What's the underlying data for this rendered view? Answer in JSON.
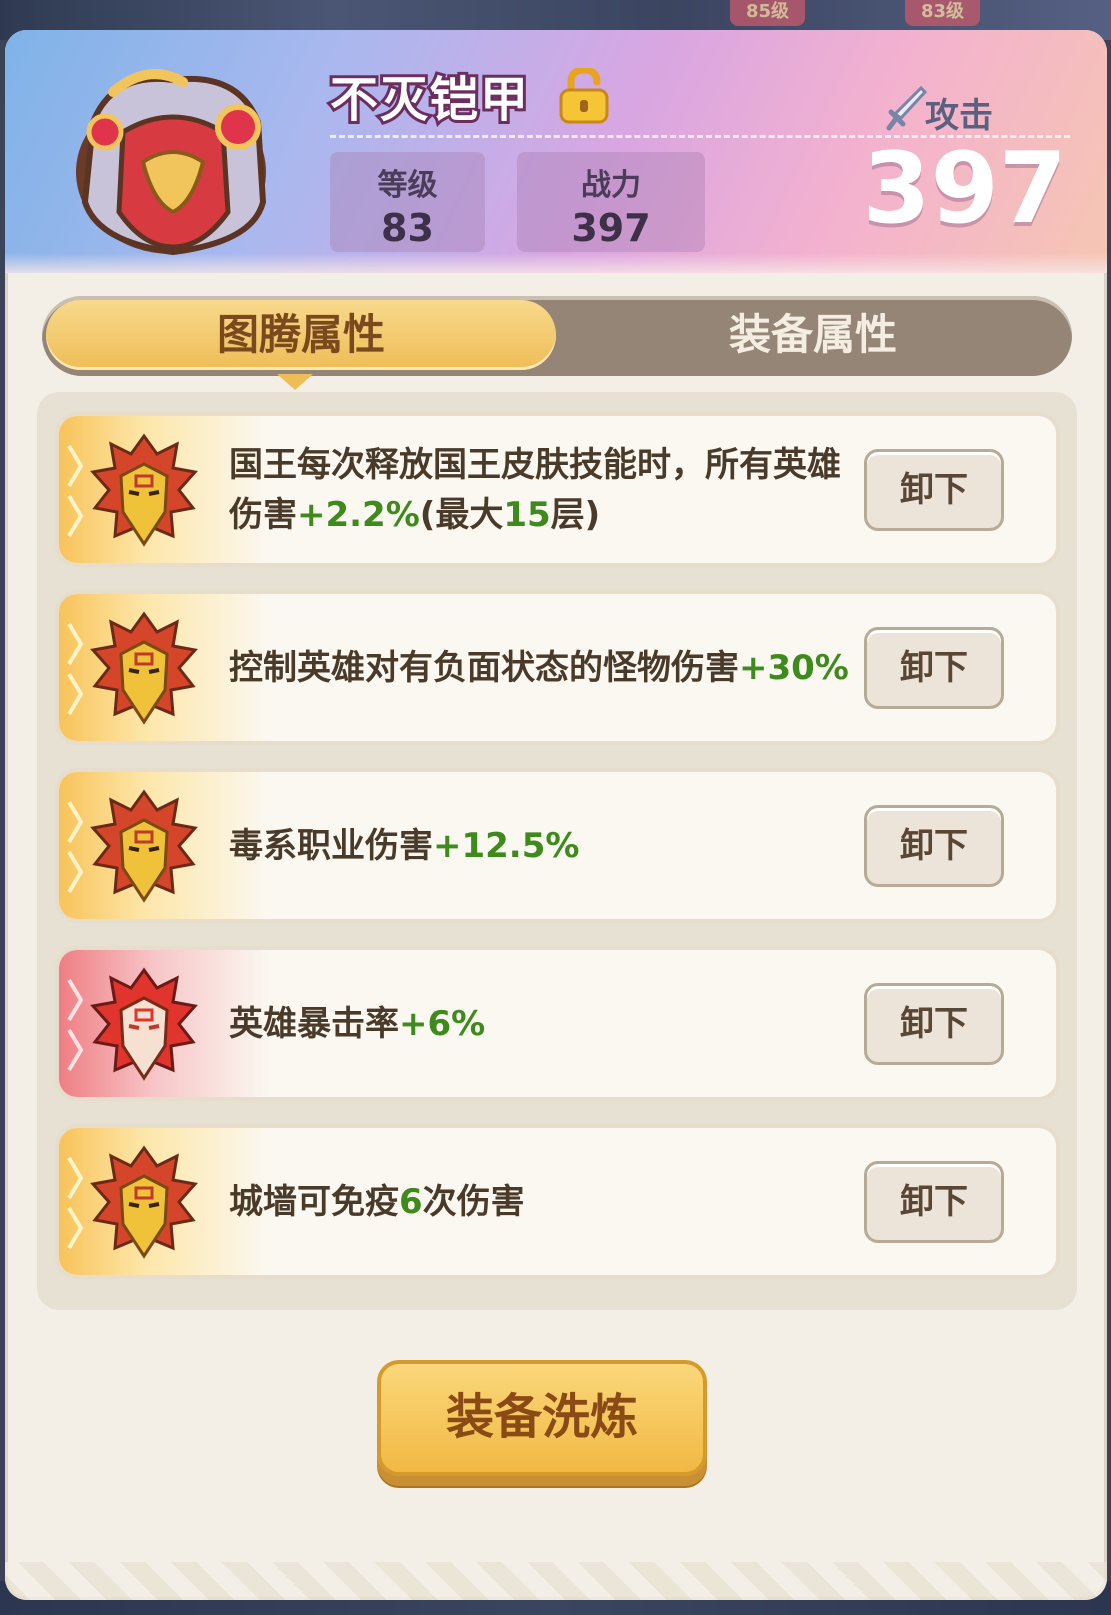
{
  "background": {
    "tags": [
      "85级",
      "83级"
    ]
  },
  "item": {
    "name": "不灭铠甲",
    "level_label": "等级",
    "level_value": "83",
    "power_label": "战力",
    "power_value": "397",
    "attack_label": "攻击",
    "attack_value": "397"
  },
  "tabs": {
    "active": "图腾属性",
    "inactive": "装备属性"
  },
  "rows": [
    {
      "prefix": "国王每次释放国王皮肤技能时，所有英雄伤害",
      "hl1": "+2.2%",
      "mid": "(最大",
      "hl2": "15",
      "suffix": "层)",
      "button": "卸下",
      "rarity": "gold"
    },
    {
      "prefix": "控制英雄对有负面状态的怪物伤害",
      "hl1": "+30%",
      "mid": "",
      "hl2": "",
      "suffix": "",
      "button": "卸下",
      "rarity": "gold"
    },
    {
      "prefix": "毒系职业伤害",
      "hl1": "+12.5%",
      "mid": "",
      "hl2": "",
      "suffix": "",
      "button": "卸下",
      "rarity": "gold"
    },
    {
      "prefix": "英雄暴击率",
      "hl1": "+6%",
      "mid": "",
      "hl2": "",
      "suffix": "",
      "button": "卸下",
      "rarity": "red"
    },
    {
      "prefix": "城墙可免疫",
      "hl1": "6",
      "mid": "次伤害",
      "hl2": "",
      "suffix": "",
      "button": "卸下",
      "rarity": "gold"
    }
  ],
  "refine_button": "装备洗炼",
  "colors": {
    "highlight": "#3e8a1c",
    "tab_active": "#eebd56",
    "tab_bar": "#948577",
    "button_gold": "#f1b943"
  }
}
